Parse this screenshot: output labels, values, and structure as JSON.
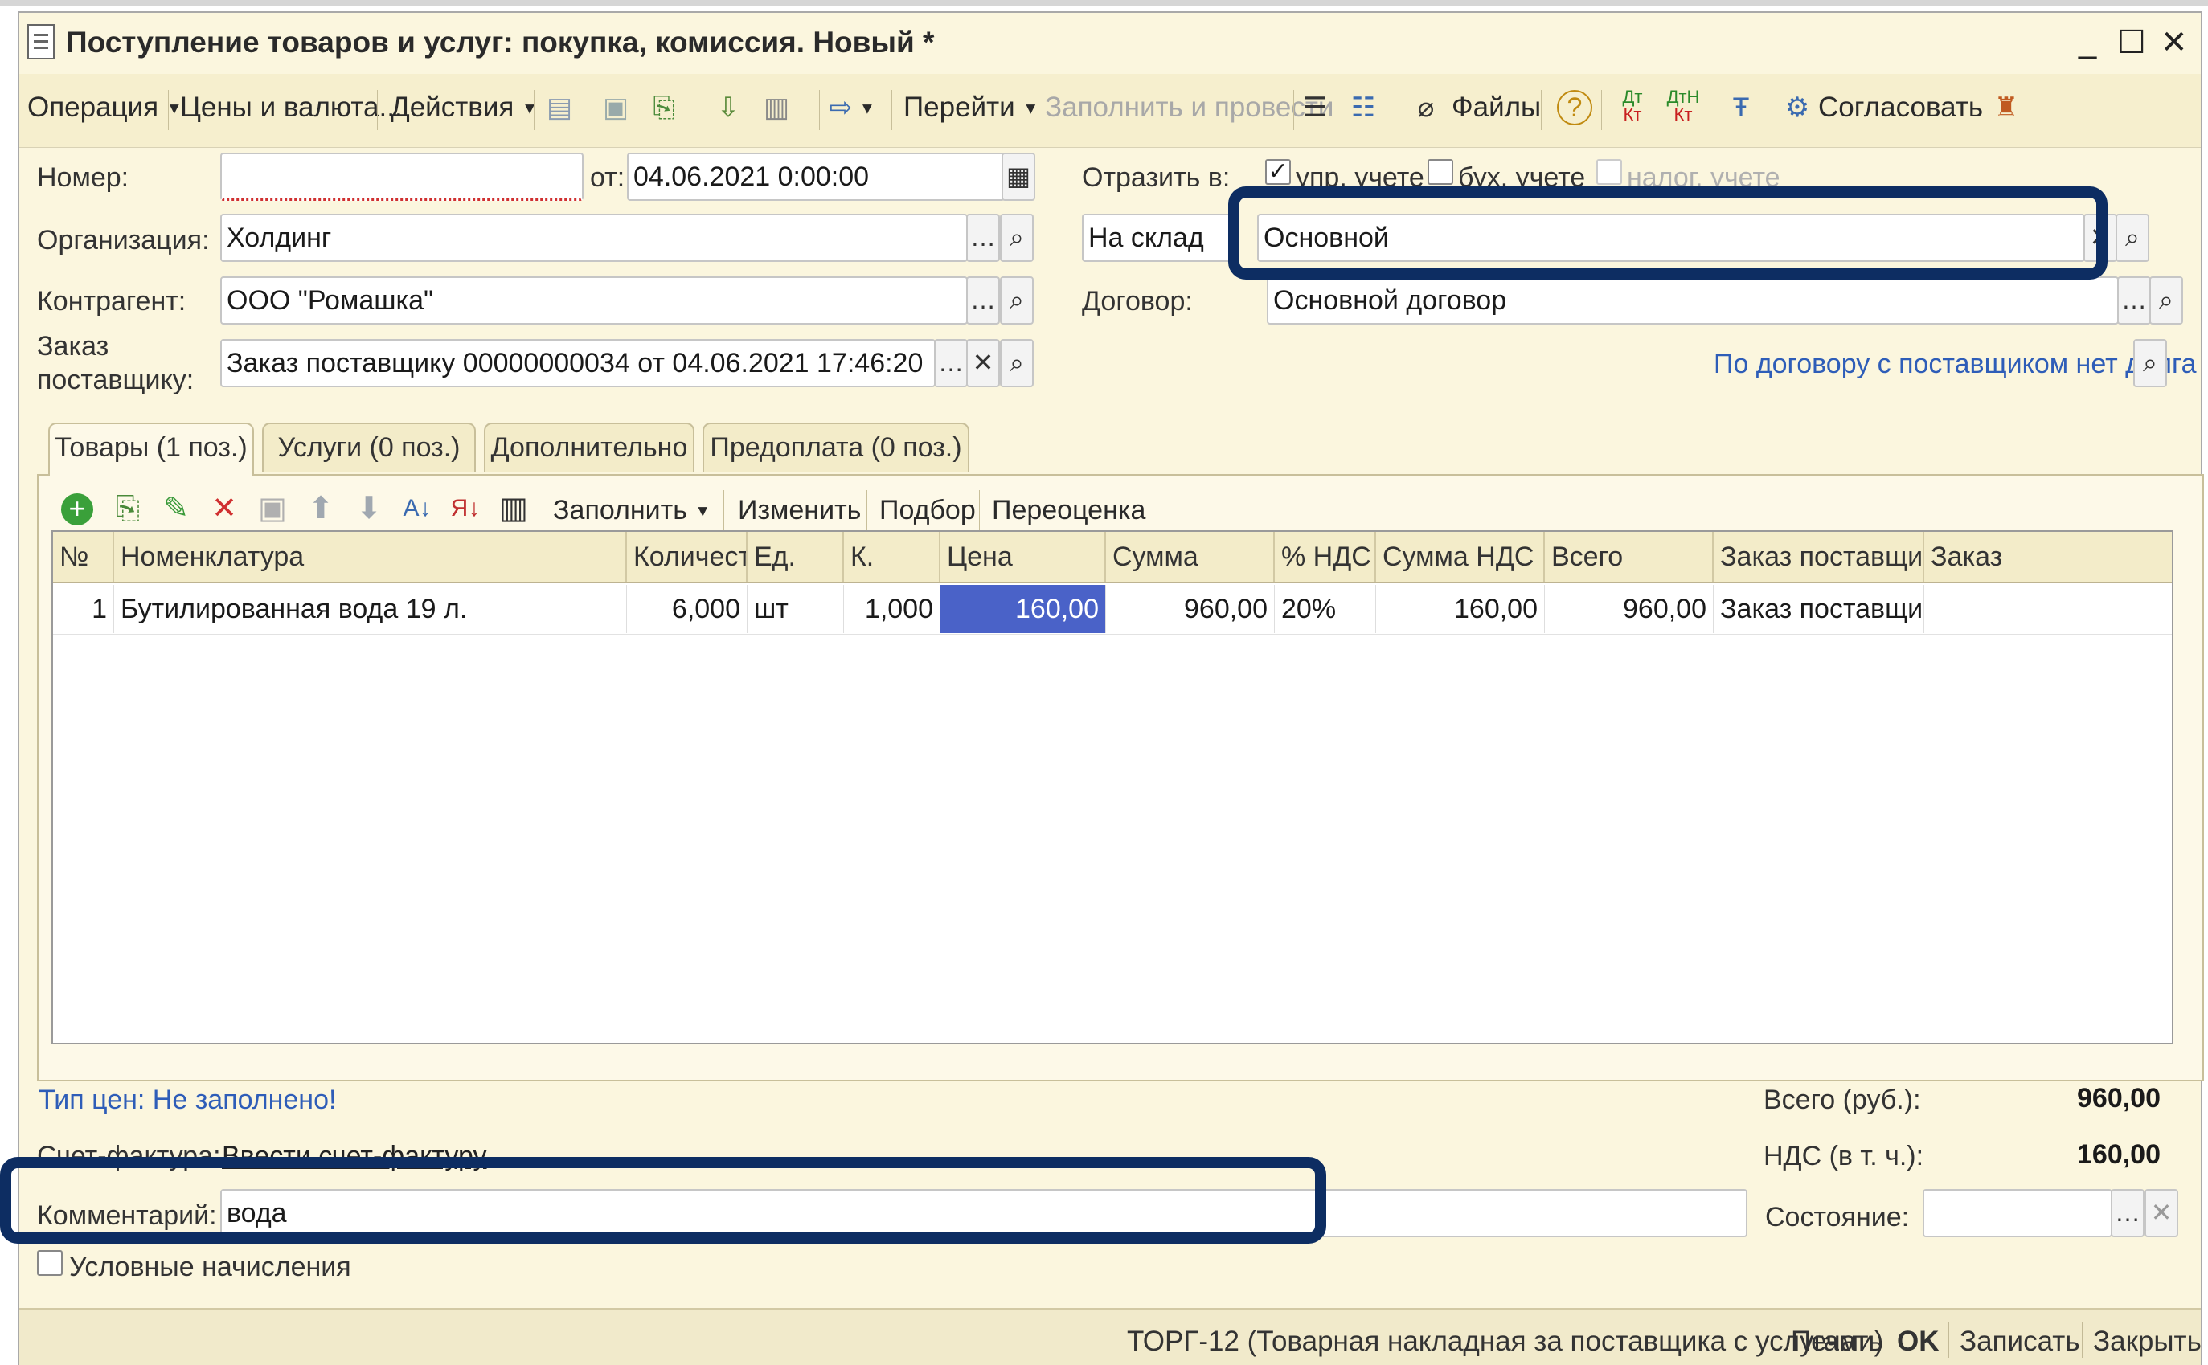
{
  "window": {
    "title": "Поступление товаров и услуг: покупка, комиссия. Новый *",
    "minimize": "_",
    "maximize": "☐",
    "close": "✕"
  },
  "toolbar": {
    "operation": "Операция",
    "prices": "Цены и валюта...",
    "actions": "Действия",
    "goto": "Перейти",
    "fill_and_post": "Заполнить и провести",
    "files": "Файлы",
    "approve": "Согласовать"
  },
  "form": {
    "number_label": "Номер:",
    "number_value": "",
    "from_label": "от:",
    "date_value": "04.06.2021  0:00:00",
    "reflect_label": "Отразить в:",
    "reflect_mgmt": "упр. учете",
    "reflect_acc": "бух. учете",
    "reflect_tax": "налог. учете",
    "org_label": "Организация:",
    "org_value": "Холдинг",
    "warehouse_kind": "На склад",
    "warehouse_value": "Основной",
    "counterparty_label": "Контрагент:",
    "counterparty_value": "ООО \"Ромашка\"",
    "contract_label": "Договор:",
    "contract_value": "Основной договор",
    "order_label_1": "Заказ",
    "order_label_2": "поставщику:",
    "order_value": "Заказ поставщику 00000000034 от 04.06.2021 17:46:20",
    "debt_link": "По договору с поставщиком нет долга"
  },
  "tabs": [
    {
      "label": "Товары (1 поз.)"
    },
    {
      "label": "Услуги (0 поз.)"
    },
    {
      "label": "Дополнительно"
    },
    {
      "label": "Предоплата (0 поз.)"
    }
  ],
  "grid_toolbar": {
    "fill": "Заполнить",
    "edit": "Изменить",
    "selection": "Подбор",
    "revaluation": "Переоценка"
  },
  "grid": {
    "columns": [
      "№",
      "Номенклатура",
      "Количест...",
      "Ед.",
      "К.",
      "Цена",
      "Сумма",
      "% НДС",
      "Сумма НДС",
      "Всего",
      "Заказ поставщи...",
      "Заказ"
    ],
    "rows": [
      [
        "1",
        "Бутилированная вода 19 л.",
        "6,000",
        "шт",
        "1,000",
        "160,00",
        "960,00",
        "20%",
        "160,00",
        "960,00",
        "Заказ поставщи...",
        ""
      ]
    ]
  },
  "footer": {
    "price_type_link": "Тип цен: Не заполнено!",
    "invoice_label": "Счет-фактура:",
    "invoice_link": "Ввести счет-фактуру",
    "comment_label": "Комментарий:",
    "comment_value": "вода",
    "state_label": "Состояние:",
    "conditional_label": "Условные начисления",
    "total_label": "Всего (руб.):",
    "total_value": "960,00",
    "vat_label": "НДС (в т. ч.):",
    "vat_value": "160,00"
  },
  "statusbar": {
    "torg12": "ТОРГ-12 (Товарная накладная за поставщика с услугами)",
    "print": "Печать",
    "ok": "OK",
    "save": "Записать",
    "close": "Закрыть"
  },
  "colors": {
    "highlight": "#0d2d62",
    "link": "#2e5db8",
    "selected_cell": "#4a62c8",
    "background": "#fbf6de"
  }
}
